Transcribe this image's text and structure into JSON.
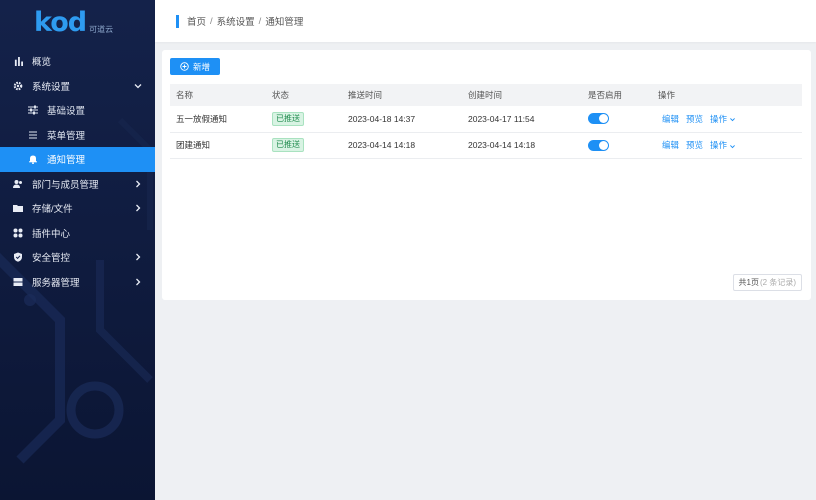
{
  "app": {
    "logo_text": "kod",
    "logo_sub": "可道云"
  },
  "sidebar": {
    "items": [
      {
        "label": "概览",
        "icon": "chart-bar-icon"
      },
      {
        "label": "系统设置",
        "icon": "gear-icon",
        "expanded": true
      },
      {
        "label": "基础设置",
        "icon": "sliders-icon"
      },
      {
        "label": "菜单管理",
        "icon": "menu-lines-icon"
      },
      {
        "label": "通知管理",
        "icon": "bell-icon",
        "active": true
      },
      {
        "label": "部门与成员管理",
        "icon": "users-icon"
      },
      {
        "label": "存储/文件",
        "icon": "folder-icon"
      },
      {
        "label": "插件中心",
        "icon": "grid-icon"
      },
      {
        "label": "安全管控",
        "icon": "shield-icon"
      },
      {
        "label": "服务器管理",
        "icon": "server-icon"
      }
    ]
  },
  "breadcrumb": {
    "items": [
      "首页",
      "系统设置",
      "通知管理"
    ],
    "separator": "/"
  },
  "toolbar": {
    "add_label": "新增"
  },
  "table": {
    "columns": [
      "名称",
      "状态",
      "推送时间",
      "创建时间",
      "是否启用",
      "操作"
    ],
    "rows": [
      {
        "name": "五一放假通知",
        "status": "已推送",
        "push_time": "2023-04-18 14:37",
        "create_time": "2023-04-17 11:54",
        "enabled": true,
        "actions": [
          "编辑",
          "预览",
          "操作"
        ]
      },
      {
        "name": "团建通知",
        "status": "已推送",
        "push_time": "2023-04-14 14:18",
        "create_time": "2023-04-14 14:18",
        "enabled": true,
        "actions": [
          "编辑",
          "预览",
          "操作"
        ]
      }
    ]
  },
  "pagination": {
    "pages": "共1页",
    "records": "(2 条记录)"
  },
  "colors": {
    "accent": "#1e90f5",
    "sidebar_bg": "#14224a",
    "status_green": "#1e8a4c"
  }
}
